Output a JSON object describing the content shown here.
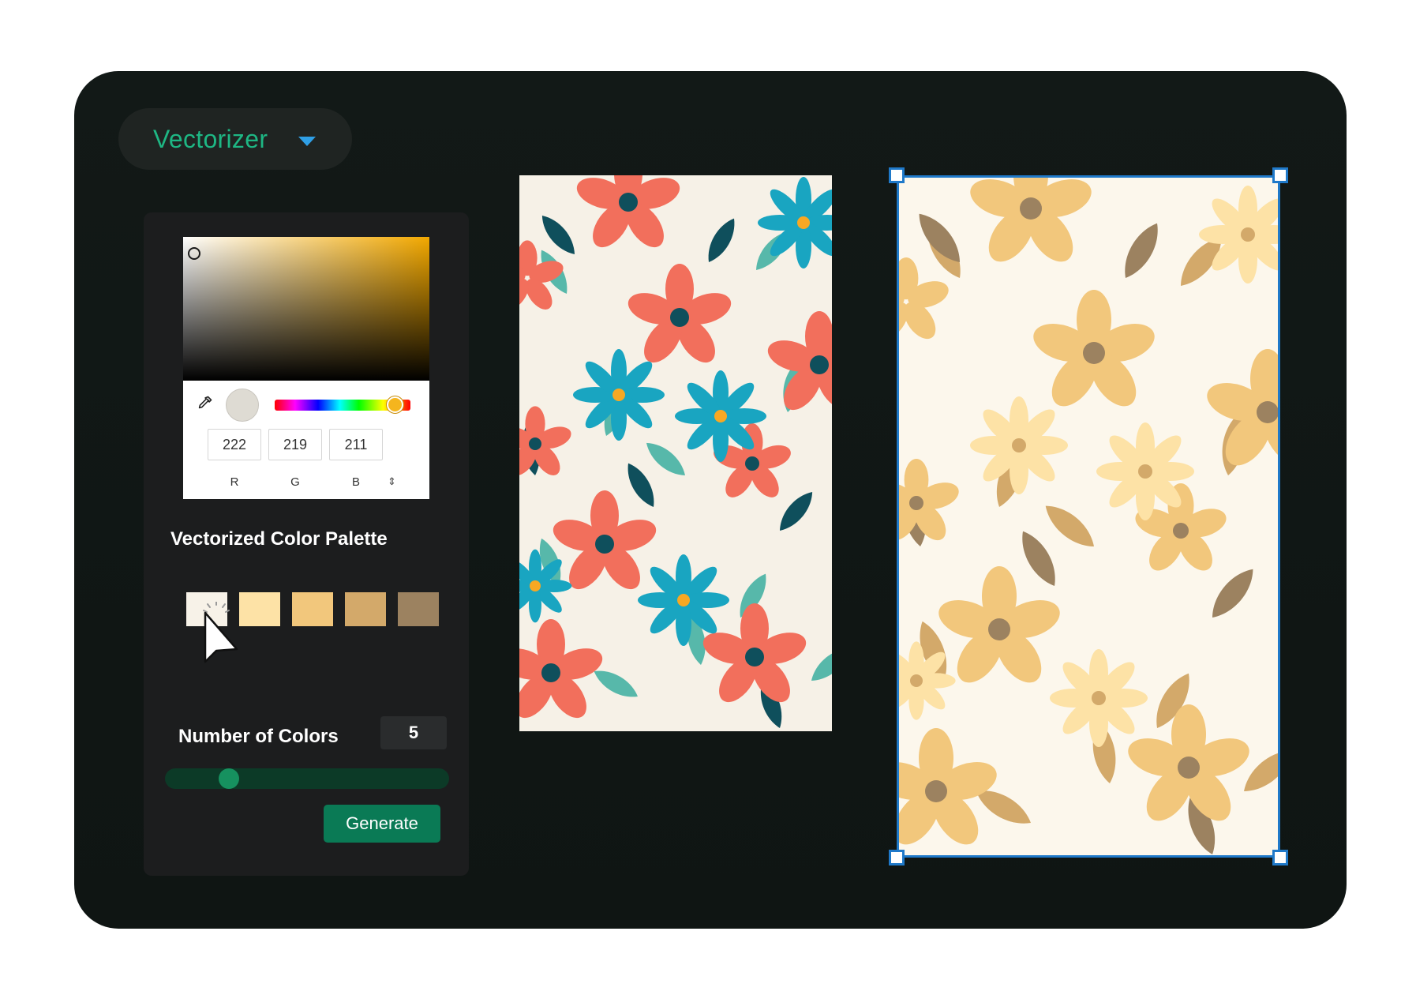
{
  "app": {
    "tool_select": {
      "label": "Vectorizer",
      "icon": "chevron-down-icon"
    }
  },
  "color_picker": {
    "selected_color": "#dedbd3",
    "eyedropper_icon": "eyedropper-icon",
    "rgb": {
      "r": "222",
      "g": "219",
      "b": "211"
    },
    "labels": {
      "r": "R",
      "g": "G",
      "b": "B"
    },
    "mode_toggle_icon": "up-down-arrows-icon"
  },
  "palette": {
    "title": "Vectorized Color Palette",
    "swatches": [
      "#f7f2e8",
      "#fde2a6",
      "#f2c77c",
      "#d3a96a",
      "#9c8260"
    ]
  },
  "number_of_colors": {
    "label": "Number of Colors",
    "value": "5"
  },
  "generate_button": {
    "label": "Generate"
  },
  "images": {
    "original": {
      "name": "floral-pattern-original",
      "colors": [
        "#f26f5c",
        "#19a5c1",
        "#57b8aa",
        "#0f4f5c"
      ]
    },
    "vectorized": {
      "name": "floral-pattern-vectorized",
      "colors": [
        "#f2c77c",
        "#fde2a6",
        "#d3a96a",
        "#9c8260"
      ]
    }
  }
}
